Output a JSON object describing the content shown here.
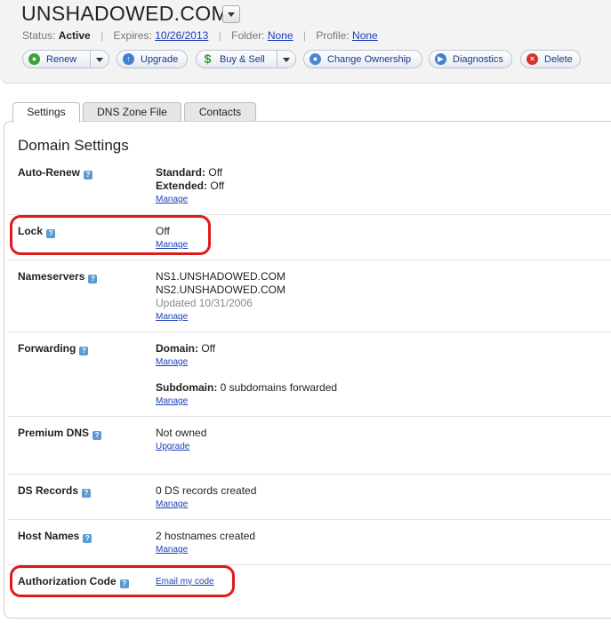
{
  "header": {
    "domain": "UNSHADOWED.COM",
    "status_label": "Status:",
    "status_value": "Active",
    "expires_label": "Expires:",
    "expires_value": "10/26/2013",
    "folder_label": "Folder:",
    "folder_value": "None",
    "profile_label": "Profile:",
    "profile_value": "None"
  },
  "toolbar": {
    "renew": "Renew",
    "upgrade": "Upgrade",
    "buy_sell": "Buy & Sell",
    "change_ownership": "Change Ownership",
    "diagnostics": "Diagnostics",
    "delete": "Delete"
  },
  "tabs": [
    "Settings",
    "DNS Zone File",
    "Contacts"
  ],
  "panel_title": "Domain Settings",
  "rows": {
    "auto_renew": {
      "label": "Auto-Renew",
      "standard_label": "Standard:",
      "standard_value": "Off",
      "extended_label": "Extended:",
      "extended_value": "Off",
      "link": "Manage"
    },
    "lock": {
      "label": "Lock",
      "value": "Off",
      "link": "Manage"
    },
    "nameservers": {
      "label": "Nameservers",
      "ns1": "NS1.UNSHADOWED.COM",
      "ns2": "NS2.UNSHADOWED.COM",
      "updated": "Updated 10/31/2006",
      "link": "Manage"
    },
    "forwarding": {
      "label": "Forwarding",
      "domain_label": "Domain:",
      "domain_value": "Off",
      "link1": "Manage",
      "subdomain_label": "Subdomain:",
      "subdomain_value": "0 subdomains forwarded",
      "link2": "Manage"
    },
    "premium_dns": {
      "label": "Premium DNS",
      "value": "Not owned",
      "link": "Upgrade"
    },
    "ds_records": {
      "label": "DS Records",
      "value": "0 DS records created",
      "link": "Manage"
    },
    "host_names": {
      "label": "Host Names",
      "value": "2 hostnames created",
      "link": "Manage"
    },
    "auth_code": {
      "label": "Authorization Code",
      "link": "Email my code"
    }
  },
  "help_glyph": "?",
  "colors": {
    "highlight": "#e01919",
    "link": "#1a3fb8",
    "help_icon": "#5b9bd5"
  },
  "icons": {
    "renew": "green-circle-icon",
    "upgrade": "blue-arrow-up-icon",
    "buy_sell": "dollar-icon",
    "change_ownership": "person-icon",
    "diagnostics": "blue-play-icon",
    "delete": "red-x-icon"
  }
}
